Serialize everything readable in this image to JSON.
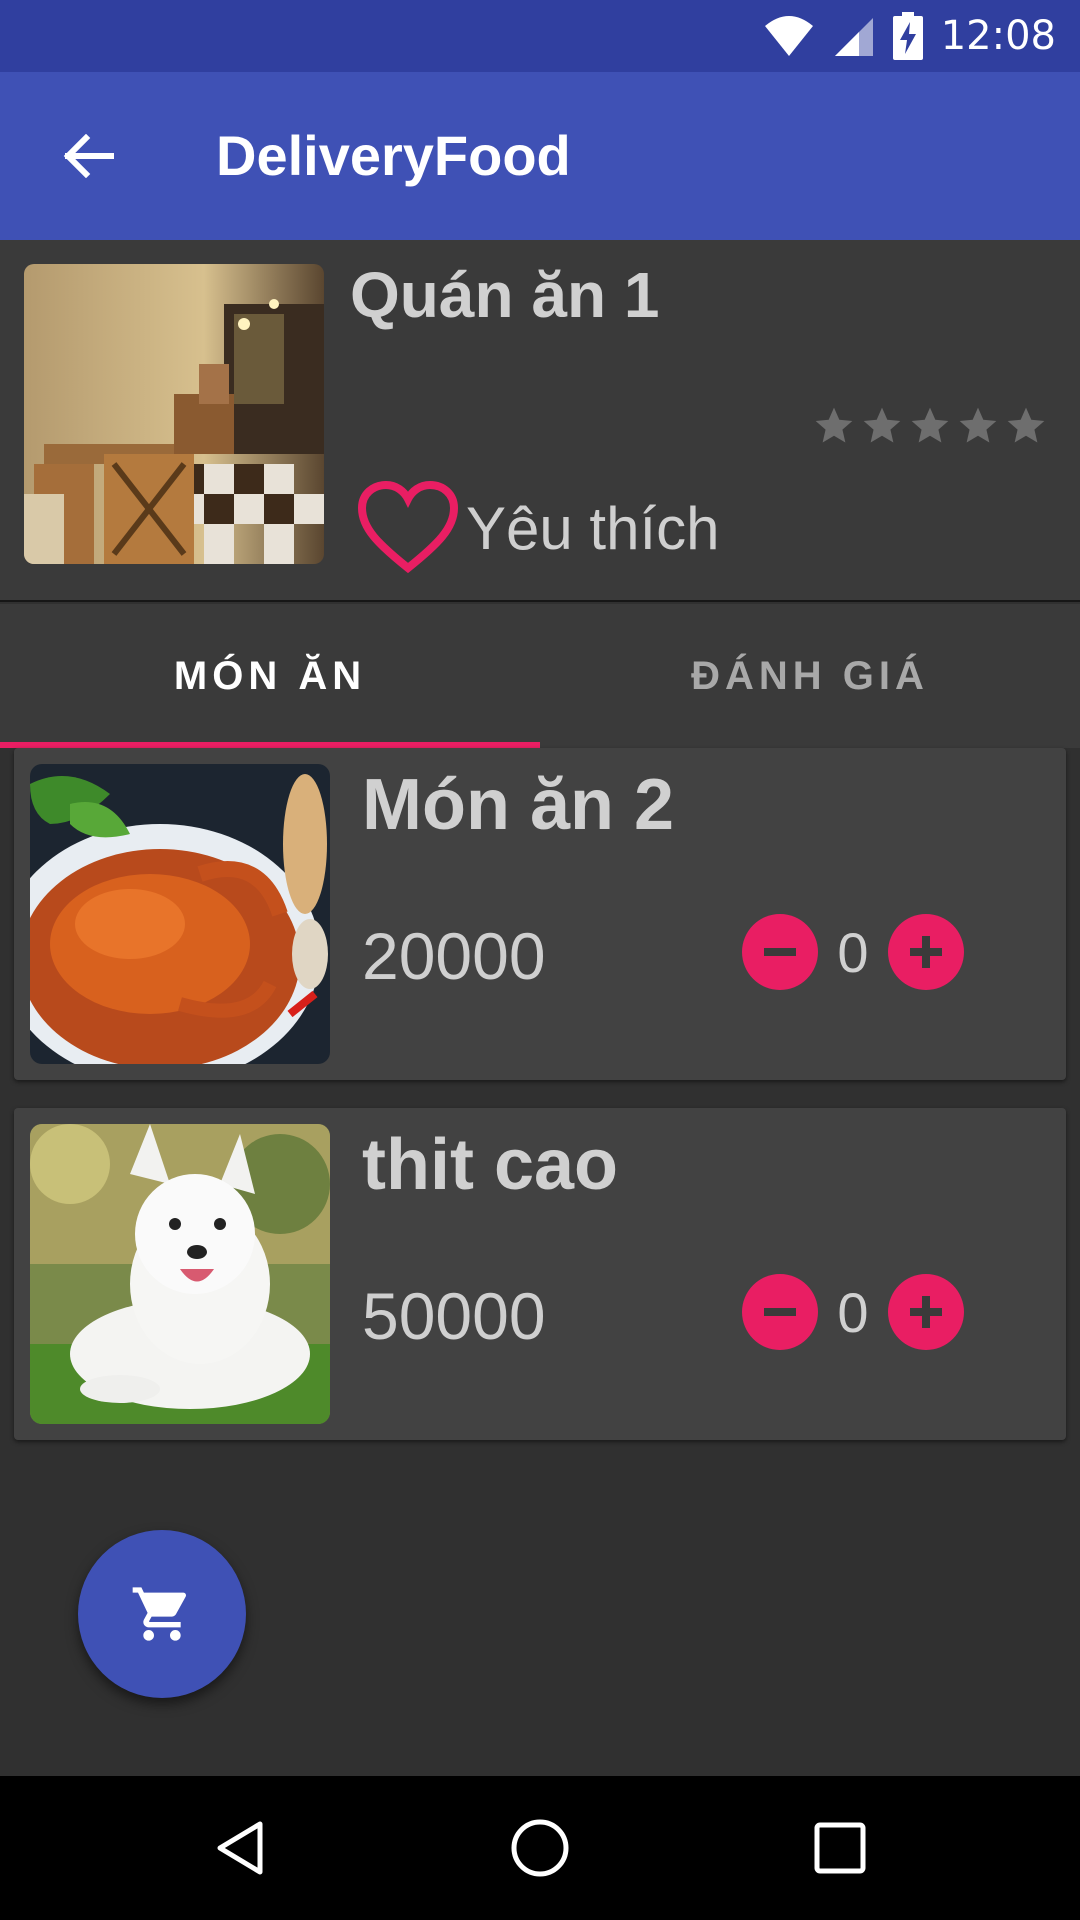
{
  "status_bar": {
    "time": "12:08",
    "icons": [
      "wifi-icon",
      "signal-icon",
      "battery-charging-icon"
    ],
    "bg": "#303f9f"
  },
  "app_bar": {
    "title": "DeliveryFood",
    "bg": "#3f51b5"
  },
  "restaurant": {
    "name": "Quán ăn 1",
    "rating": 0,
    "max_rating": 5,
    "favorite_label": "Yêu thích"
  },
  "tabs": [
    {
      "label": "MÓN ĂN",
      "active": true
    },
    {
      "label": "ĐÁNH GIÁ",
      "active": false
    }
  ],
  "foods": [
    {
      "name": "Món ăn 2",
      "price": "20000",
      "quantity": "0"
    },
    {
      "name": "thit cao",
      "price": "50000",
      "quantity": "0"
    }
  ],
  "accent": "#e91e63",
  "fab": {
    "icon": "cart-icon"
  },
  "nav_bar": {
    "icons": [
      "back-triangle-icon",
      "home-circle-icon",
      "recents-square-icon"
    ]
  }
}
